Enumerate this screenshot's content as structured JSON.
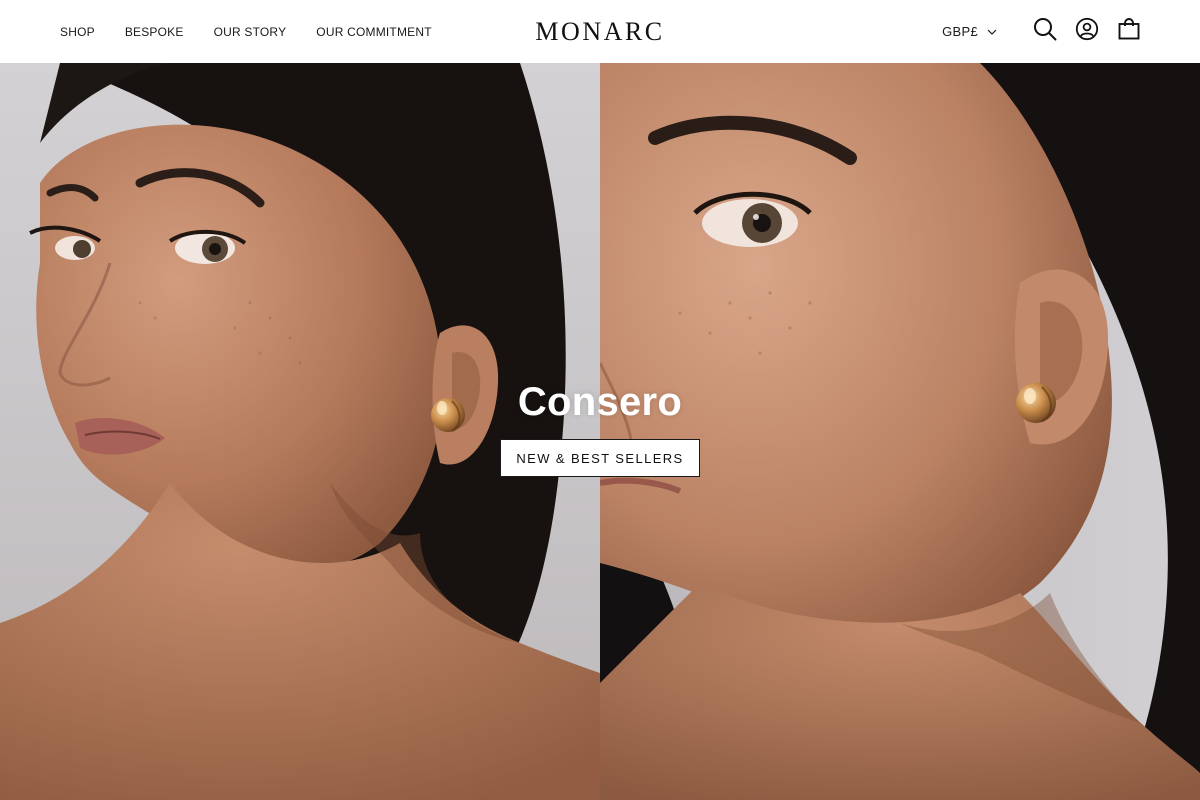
{
  "brand": {
    "name": "MONARC"
  },
  "nav": {
    "items": [
      {
        "label": "SHOP"
      },
      {
        "label": "BESPOKE"
      },
      {
        "label": "OUR STORY"
      },
      {
        "label": "OUR COMMITMENT"
      }
    ]
  },
  "header_tools": {
    "currency": "GBP£",
    "currency_icon": "chevron-down-icon",
    "search_icon": "search-icon",
    "account_icon": "account-icon",
    "cart_icon": "bag-icon"
  },
  "hero": {
    "title": "Consero",
    "cta_label": "NEW & BEST SELLERS",
    "left_image": "woman-profile-gold-earring-photo",
    "right_image": "woman-closeup-gold-earring-photo"
  },
  "colors": {
    "header_bg": "#ffffff",
    "text": "#1a1a1a",
    "hero_bg_left": "#cfcdd0",
    "hair": "#161210",
    "skin": "#c08a6c",
    "gold": "#c98c4a"
  }
}
